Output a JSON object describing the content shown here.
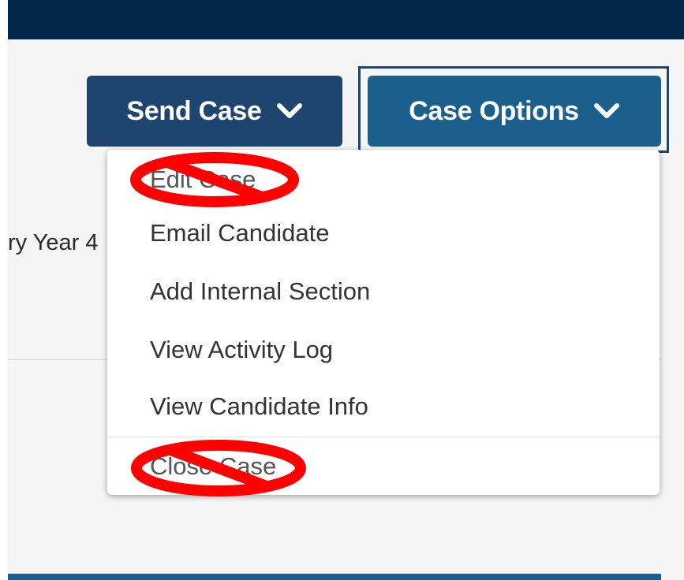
{
  "header": {
    "bar_color": "#02274a"
  },
  "background": {
    "partial_text": "ry Year 4"
  },
  "actions": {
    "send_case": {
      "label": "Send Case",
      "icon": "chevron-down-icon",
      "color": "#1e4470"
    },
    "case_options": {
      "label": "Case Options",
      "icon": "chevron-down-icon",
      "color": "#1b5f8d"
    }
  },
  "menu": {
    "items": [
      {
        "label": "Edit Case",
        "crossed_out": true
      },
      {
        "label": "Email Candidate",
        "crossed_out": false
      },
      {
        "label": "Add Internal Section",
        "crossed_out": false
      },
      {
        "label": "View Activity Log",
        "crossed_out": false
      },
      {
        "label": "View Candidate Info",
        "crossed_out": false
      },
      {
        "label": "Close Case",
        "crossed_out": true
      }
    ]
  },
  "annotations": {
    "mark": "no-sign-icon",
    "color": "#ff0000"
  }
}
